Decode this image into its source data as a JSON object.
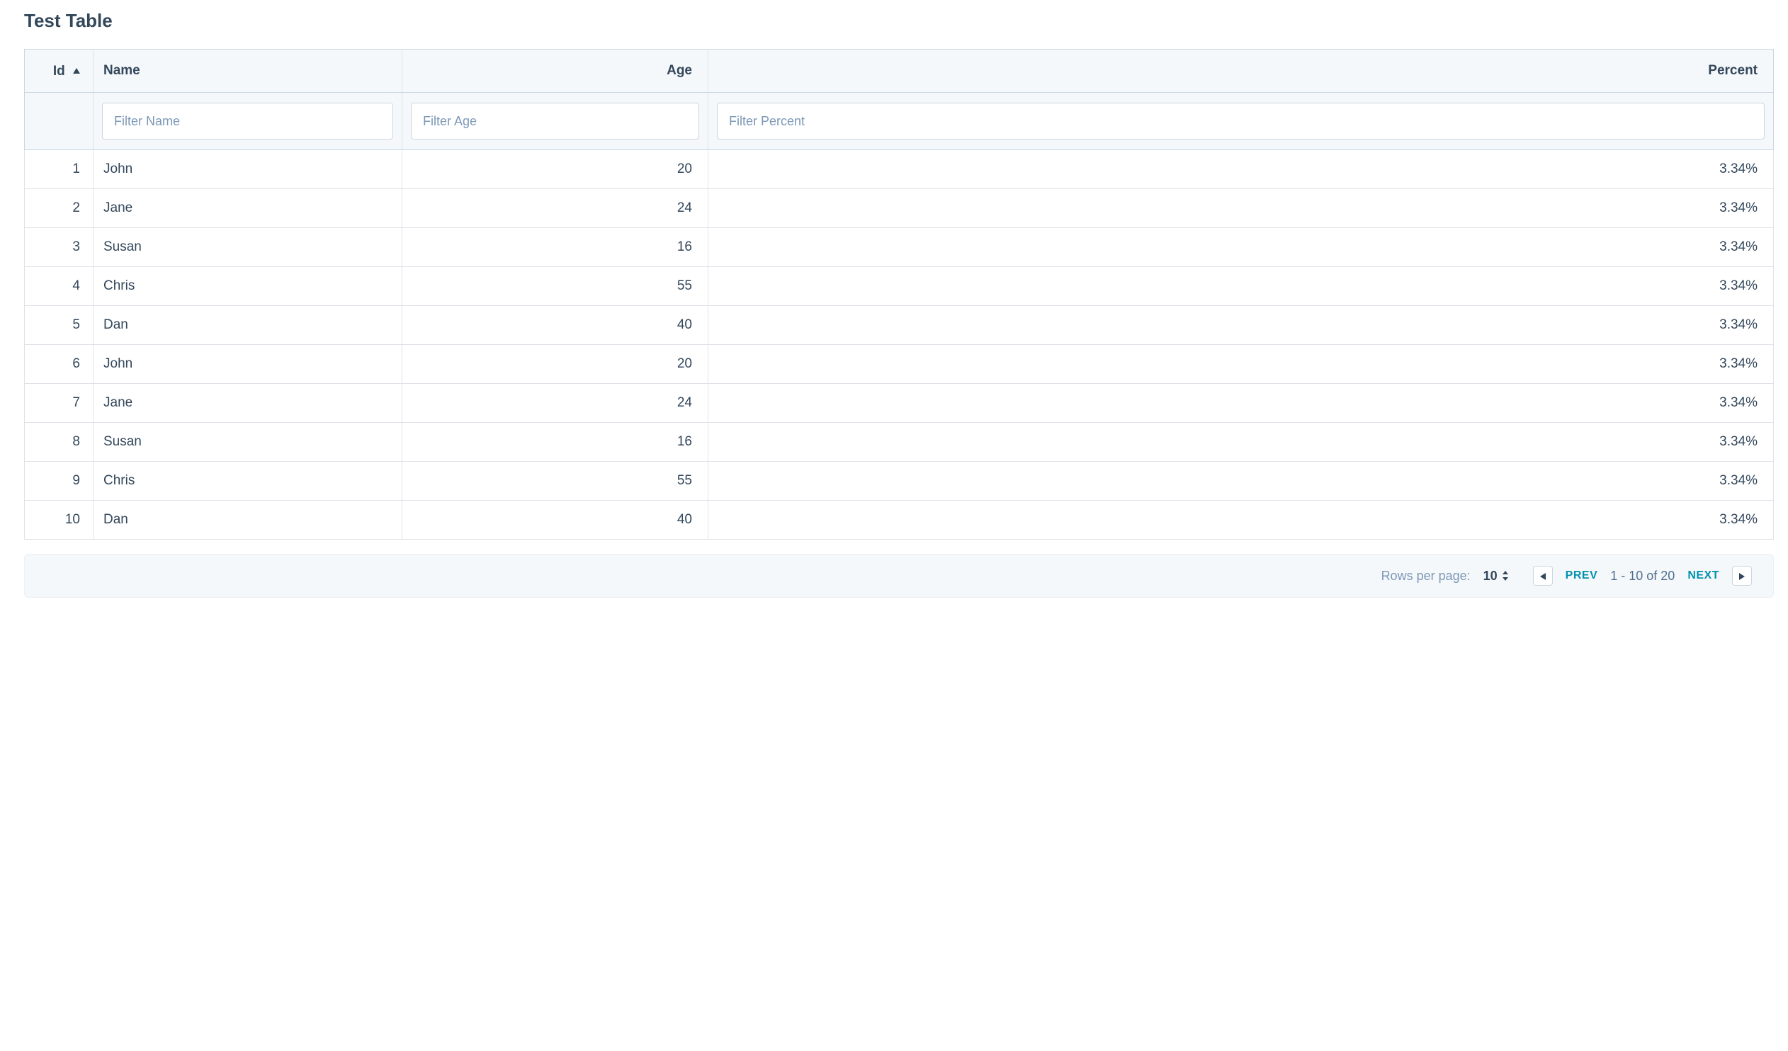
{
  "page": {
    "title": "Test Table"
  },
  "table": {
    "columns": [
      {
        "key": "id",
        "label": "Id",
        "sort": "asc",
        "filter_placeholder": null
      },
      {
        "key": "name",
        "label": "Name",
        "filter_placeholder": "Filter Name"
      },
      {
        "key": "age",
        "label": "Age",
        "filter_placeholder": "Filter Age"
      },
      {
        "key": "percent",
        "label": "Percent",
        "filter_placeholder": "Filter Percent"
      }
    ],
    "rows": [
      {
        "id": "1",
        "name": "John",
        "age": "20",
        "percent": "3.34%"
      },
      {
        "id": "2",
        "name": "Jane",
        "age": "24",
        "percent": "3.34%"
      },
      {
        "id": "3",
        "name": "Susan",
        "age": "16",
        "percent": "3.34%"
      },
      {
        "id": "4",
        "name": "Chris",
        "age": "55",
        "percent": "3.34%"
      },
      {
        "id": "5",
        "name": "Dan",
        "age": "40",
        "percent": "3.34%"
      },
      {
        "id": "6",
        "name": "John",
        "age": "20",
        "percent": "3.34%"
      },
      {
        "id": "7",
        "name": "Jane",
        "age": "24",
        "percent": "3.34%"
      },
      {
        "id": "8",
        "name": "Susan",
        "age": "16",
        "percent": "3.34%"
      },
      {
        "id": "9",
        "name": "Chris",
        "age": "55",
        "percent": "3.34%"
      },
      {
        "id": "10",
        "name": "Dan",
        "age": "40",
        "percent": "3.34%"
      }
    ]
  },
  "pagination": {
    "rows_per_page_label": "Rows per page:",
    "rows_per_page_value": "10",
    "range_text": "1 - 10 of 20",
    "prev_label": "PREV",
    "next_label": "NEXT"
  }
}
